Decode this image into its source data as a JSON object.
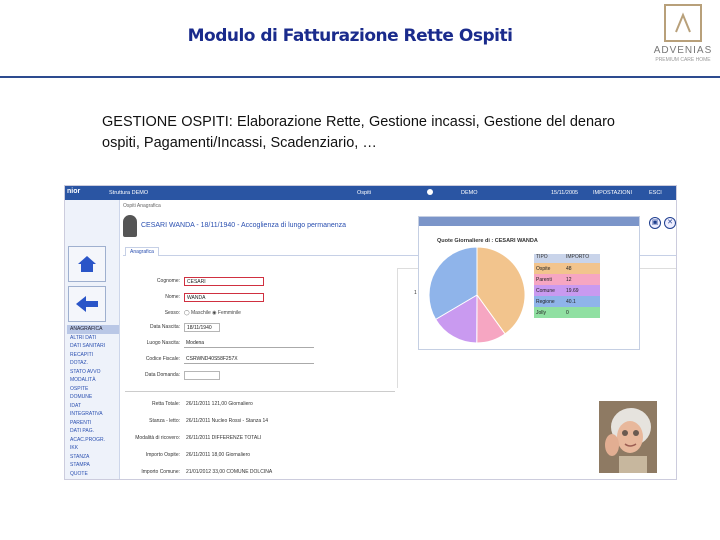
{
  "slide": {
    "title": "Modulo di Fatturazione Rette Ospiti",
    "intro": "GESTIONE OSPITI: Elaborazione Rette, Gestione incassi, Gestione del denaro ospiti, Pagamenti/Incassi, Scadenziario, …"
  },
  "logo": {
    "name": "ADVENIAS",
    "tagline": "PREMIUM CARE HOME"
  },
  "app": {
    "brand": "nior",
    "topbar": {
      "facility": "Struttura DEMO",
      "section": "Ospiti",
      "user": "DEMO",
      "date": "15/11/2005",
      "settings": "IMPOSTAZIONI",
      "exit": "ESCI"
    },
    "breadcrumb": "Ospiti Anagrafica",
    "patient_header": "CESARI WANDA - 18/11/1940 - Accoglienza di lungo permanenza",
    "tab": "Anagrafica",
    "sidebar": {
      "heading": "ANAGRAFICA",
      "items": [
        "ALTRI DATI",
        "DATI SANITARI",
        "RECAPITI",
        "DOTAZ.",
        "STATO AVVO",
        "MODALITÀ",
        "OSPITE",
        "DOMUNE",
        "IDAT",
        "INTEGRATIVA",
        "PARENTI",
        "DATI PAG.",
        "ACAC.PROGR.",
        "IKK",
        "STANZA",
        "STAMPA",
        "QUOTE"
      ]
    },
    "form": {
      "cognome_label": "Cognome:",
      "cognome": "CESARI",
      "nome_label": "Nome:",
      "nome": "WANDA",
      "sesso_label": "Sesso:",
      "sesso_m": "Maschile",
      "sesso_f": "Femminile",
      "nascita_label": "Data Nascita:",
      "nascita": "18/11/1940",
      "luogo_label": "Luogo Nascita:",
      "luogo": "Modena",
      "cf_label": "Codice Fiscale:",
      "cf": "CSRWND40S58F257X",
      "domanda_label": "Data Domanda:"
    },
    "details": [
      {
        "label": "Retta Totale:",
        "text": "26/11/2011 121,00 Giornaliero"
      },
      {
        "label": "Stanza - letto:",
        "text": "26/11/2011 Nucleo Rossi - Stanza 14"
      },
      {
        "label": "Modalità di ricovero:",
        "text": "26/11/2011 DIFFERENZE TOTALI"
      },
      {
        "label": "Importo Ospite:",
        "text": "26/11/2011 18,00 Giornaliero"
      },
      {
        "label": "Importo Comune:",
        "text": "21/01/2012 33,00 COMUNE DOLCINA"
      }
    ]
  },
  "chart_data": {
    "type": "pie",
    "title": "Quote Giornaliere di : CESARI WANDA",
    "columns": [
      "TIPO",
      "IMPORTO"
    ],
    "categories": [
      "Ospite",
      "Parenti",
      "Comune",
      "Regione",
      "Jolly"
    ],
    "values": [
      48,
      12,
      19.69,
      40.1,
      0
    ],
    "labels": [
      "48",
      "12",
      "19.69",
      "40.1",
      "0"
    ],
    "colors": [
      "#f2c48d",
      "#f6a6c2",
      "#c99af0",
      "#8fb4ea",
      "#90e0a2"
    ]
  }
}
